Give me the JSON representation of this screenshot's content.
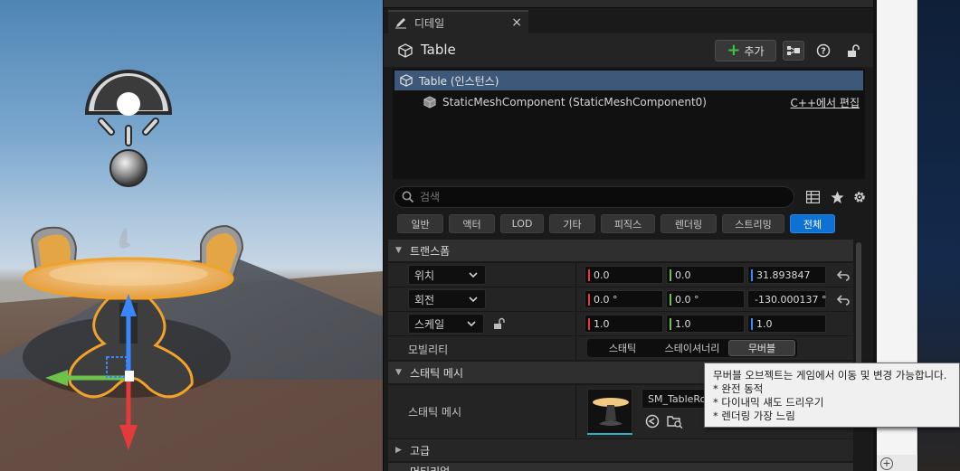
{
  "details_panel": {
    "tab_label": "디테일",
    "tab_close": "×",
    "title": "Table",
    "add_button_label": "추가",
    "add_button_plus": "+",
    "tree": {
      "root_label": "Table (인스턴스)",
      "child_label": "StaticMeshComponent (StaticMeshComponent0)",
      "edit_in_cpp_label": "C++에서 편집"
    },
    "search": {
      "placeholder": "검색",
      "value": ""
    },
    "filters": [
      "일반",
      "액터",
      "LOD",
      "기타",
      "피직스",
      "렌더링",
      "스트리밍",
      "전체"
    ],
    "active_filter": "전체",
    "transform": {
      "category_label": "트랜스폼",
      "location": {
        "label": "위치",
        "x": "0.0",
        "y": "0.0",
        "z": "31.893847"
      },
      "rotation": {
        "label": "회전",
        "x": "0.0 °",
        "y": "0.0 °",
        "z": "-130.000137 °"
      },
      "scale": {
        "label": "스케일",
        "x": "1.0",
        "y": "1.0",
        "z": "1.0"
      },
      "mobility": {
        "label": "모빌리티",
        "options": [
          "스태틱",
          "스테이셔너리",
          "무버블"
        ],
        "selected": "무버블"
      }
    },
    "static_mesh": {
      "category_label": "스태틱 메시",
      "property_label": "스태틱 메시",
      "asset_name": "SM_TableRo"
    },
    "advanced_label": "고급",
    "partial_next_label": "머티리얼"
  },
  "tooltip": {
    "line1": "무버블 오브젝트는 게임에서 이동 및 변경 가능합니다.",
    "line2": "* 완전 동적",
    "line3": "* 다이내믹 섀도 드리우기",
    "line4": "* 렌더링 가장 느림"
  },
  "colors": {
    "selected_row": "#3d5878",
    "active_filter": "#0e72d4",
    "axis_x": "#e33b3b",
    "axis_y": "#6cc24a",
    "axis_z": "#3a86ff",
    "add_plus": "#3ec43e"
  },
  "icons": {
    "tab": "pencil-icon",
    "title": "cube-icon",
    "blueprint": "blueprint-icon",
    "help": "help-icon",
    "lock": "lock-icon",
    "search": "search-icon",
    "table_view": "table-view-icon",
    "favorite": "star-icon",
    "settings": "gear-icon",
    "reset": "reset-arrow-icon"
  }
}
